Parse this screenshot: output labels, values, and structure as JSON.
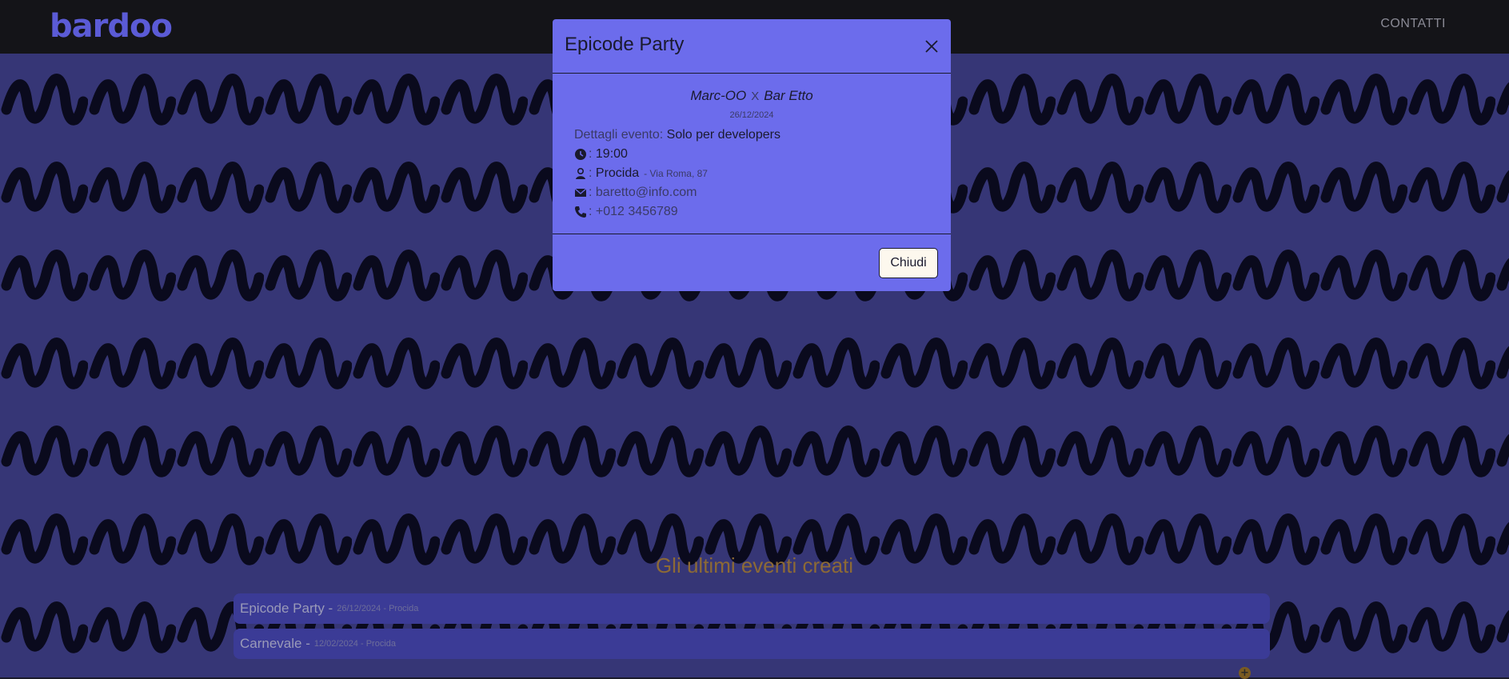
{
  "navbar": {
    "logo": "bardoo",
    "contact_link": "CONTATTI"
  },
  "events": {
    "title": "Gli ultimi eventi creati",
    "items": [
      {
        "name": "Epicode Party -",
        "meta": "26/12/2024 - Procida"
      },
      {
        "name": "Carnevale -",
        "meta": "12/02/2024 - Procida"
      }
    ],
    "add_icon": "plus-icon"
  },
  "modal": {
    "title": "Epicode Party",
    "artist": "Marc-OO",
    "separator": "X",
    "venue": "Bar Etto",
    "date": "26/12/2024",
    "details_label": "Dettagli evento:",
    "details_value": "Solo per developers",
    "time": "19:00",
    "city": "Procida",
    "address": "- Via Roma, 87",
    "email": "baretto@info.com",
    "phone": "+012 3456789",
    "colon": ":",
    "close_button": "Chiudi"
  },
  "colors": {
    "accent": "#6c6cec",
    "navbar": "#141418",
    "events_title": "#8d6a35",
    "event_row": "#3b3b96"
  }
}
